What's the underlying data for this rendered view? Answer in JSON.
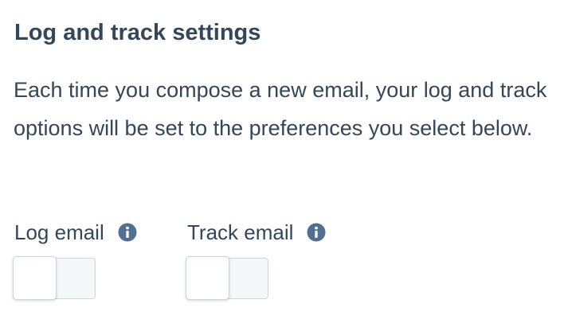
{
  "section": {
    "title": "Log and track settings",
    "description": "Each time you compose a new email, your log and track options will be set to the preferences you select below."
  },
  "options": [
    {
      "label": "Log email",
      "icon": "info-icon",
      "toggle_state": "off"
    },
    {
      "label": "Track email",
      "icon": "info-icon",
      "toggle_state": "off"
    }
  ],
  "colors": {
    "text": "#33475b",
    "icon": "#516f90",
    "toggle_border": "#cbd6e2",
    "toggle_fill": "#f5f8fa"
  }
}
